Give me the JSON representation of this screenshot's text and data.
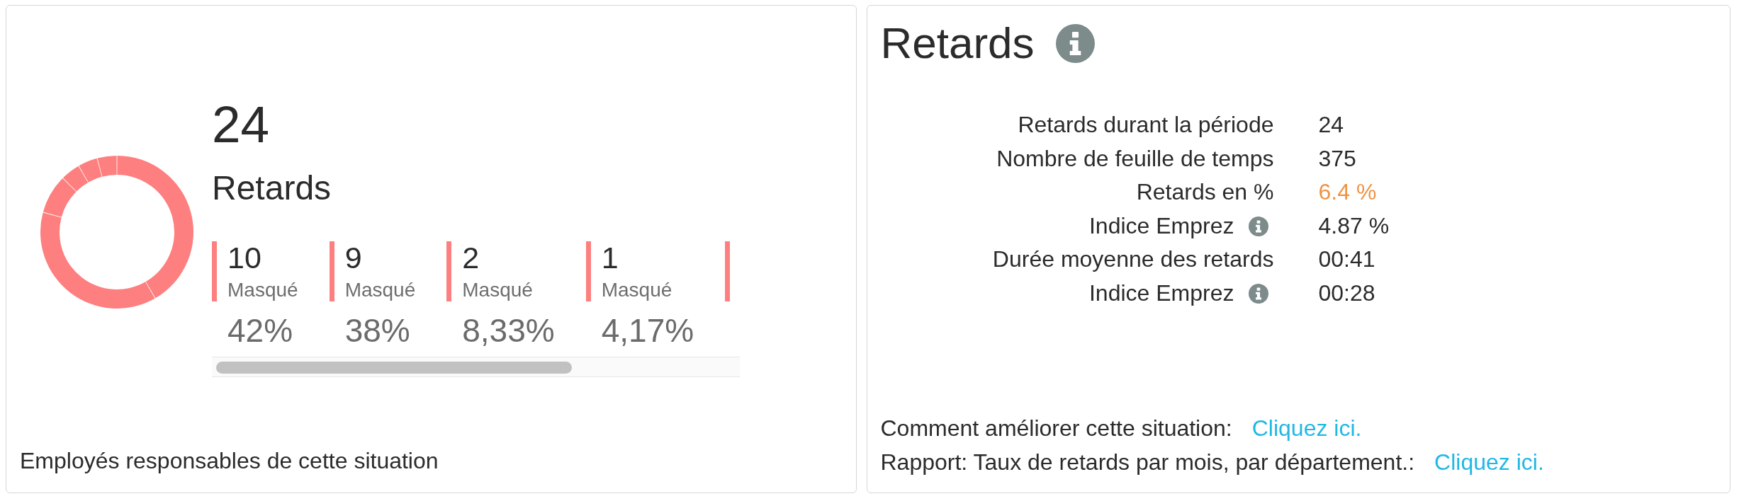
{
  "left_panel": {
    "total": "24",
    "title": "Retards",
    "legend": {
      "items": [
        {
          "count": "10",
          "label": "Masqué",
          "percent": "42%"
        },
        {
          "count": "9",
          "label": "Masqué",
          "percent": "38%"
        },
        {
          "count": "2",
          "label": "Masqué",
          "percent": "8,33%"
        },
        {
          "count": "1",
          "label": "Masqué",
          "percent": "4,17%"
        }
      ],
      "overflow": true
    },
    "footer": "Employés responsables de cette situation"
  },
  "right_panel": {
    "title": "Retards",
    "stats": [
      {
        "label": "Retards durant la période",
        "value": "24",
        "info": false,
        "warning": false
      },
      {
        "label": "Nombre de feuille de temps",
        "value": "375",
        "info": false,
        "warning": false
      },
      {
        "label": "Retards en %",
        "value": "6.4 %",
        "info": false,
        "warning": true
      },
      {
        "label": "Indice Emprez",
        "value": "4.87 %",
        "info": true,
        "warning": false
      },
      {
        "label": "Durée moyenne des retards",
        "value": "00:41",
        "info": false,
        "warning": false
      },
      {
        "label": "Indice Emprez",
        "value": "00:28",
        "info": true,
        "warning": false
      }
    ],
    "links": [
      {
        "text": "Comment améliorer cette situation:",
        "link": "Cliquez ici."
      },
      {
        "text": "Rapport: Taux de retards par mois, par département.:",
        "link": "Cliquez ici."
      }
    ]
  }
}
